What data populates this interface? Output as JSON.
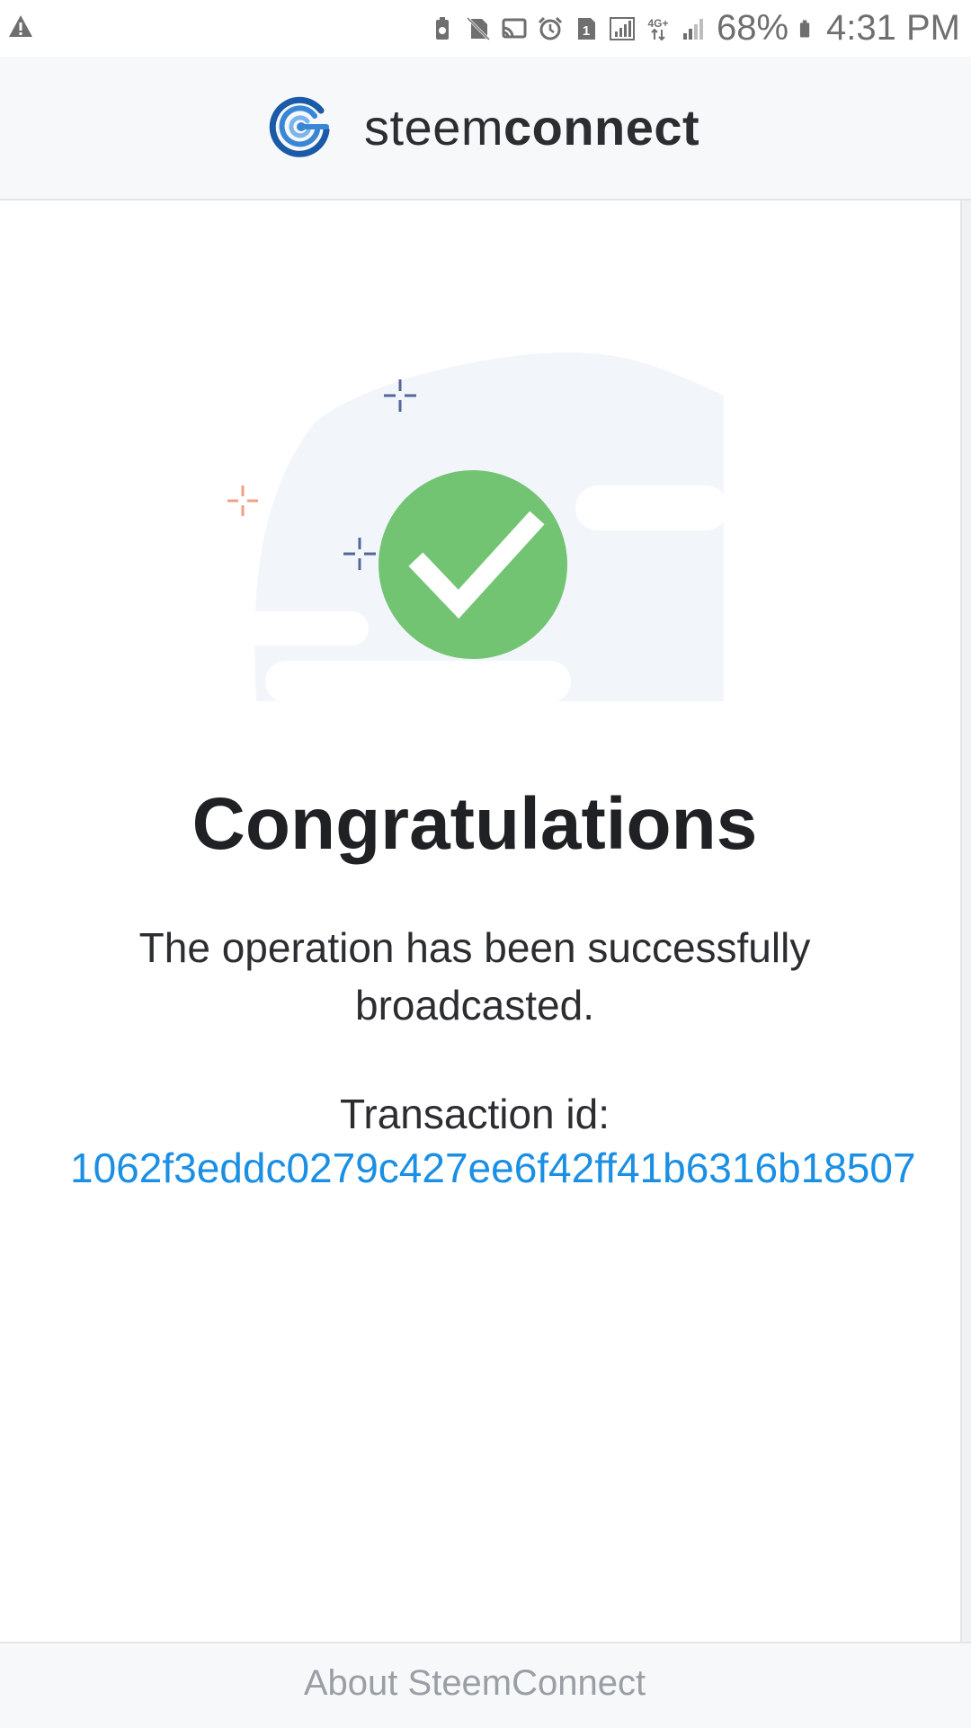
{
  "status_bar": {
    "battery_percent": "68%",
    "time": "4:31 PM",
    "icons": [
      "warning-icon",
      "battery-saver-icon",
      "no-sim-icon",
      "cast-icon",
      "alarm-icon",
      "sim-1-icon",
      "signal-icon",
      "network-4g-icon",
      "signal-weak-icon",
      "battery-icon"
    ]
  },
  "header": {
    "brand_light": "steem",
    "brand_bold": "connect",
    "logo": "steemconnect-logo"
  },
  "main": {
    "illustration": "success-check-illustration",
    "title": "Congratulations",
    "message": "The operation has been successfully broadcasted.",
    "transaction_label": "Transaction id:",
    "transaction_id": "1062f3eddc0279c427ee6f42ff41b6316b18507"
  },
  "footer": {
    "about_link": "About SteemConnect"
  },
  "colors": {
    "success_green": "#72c472",
    "link_blue": "#1a8fe3",
    "brand_blue": "#1a5aa6"
  }
}
